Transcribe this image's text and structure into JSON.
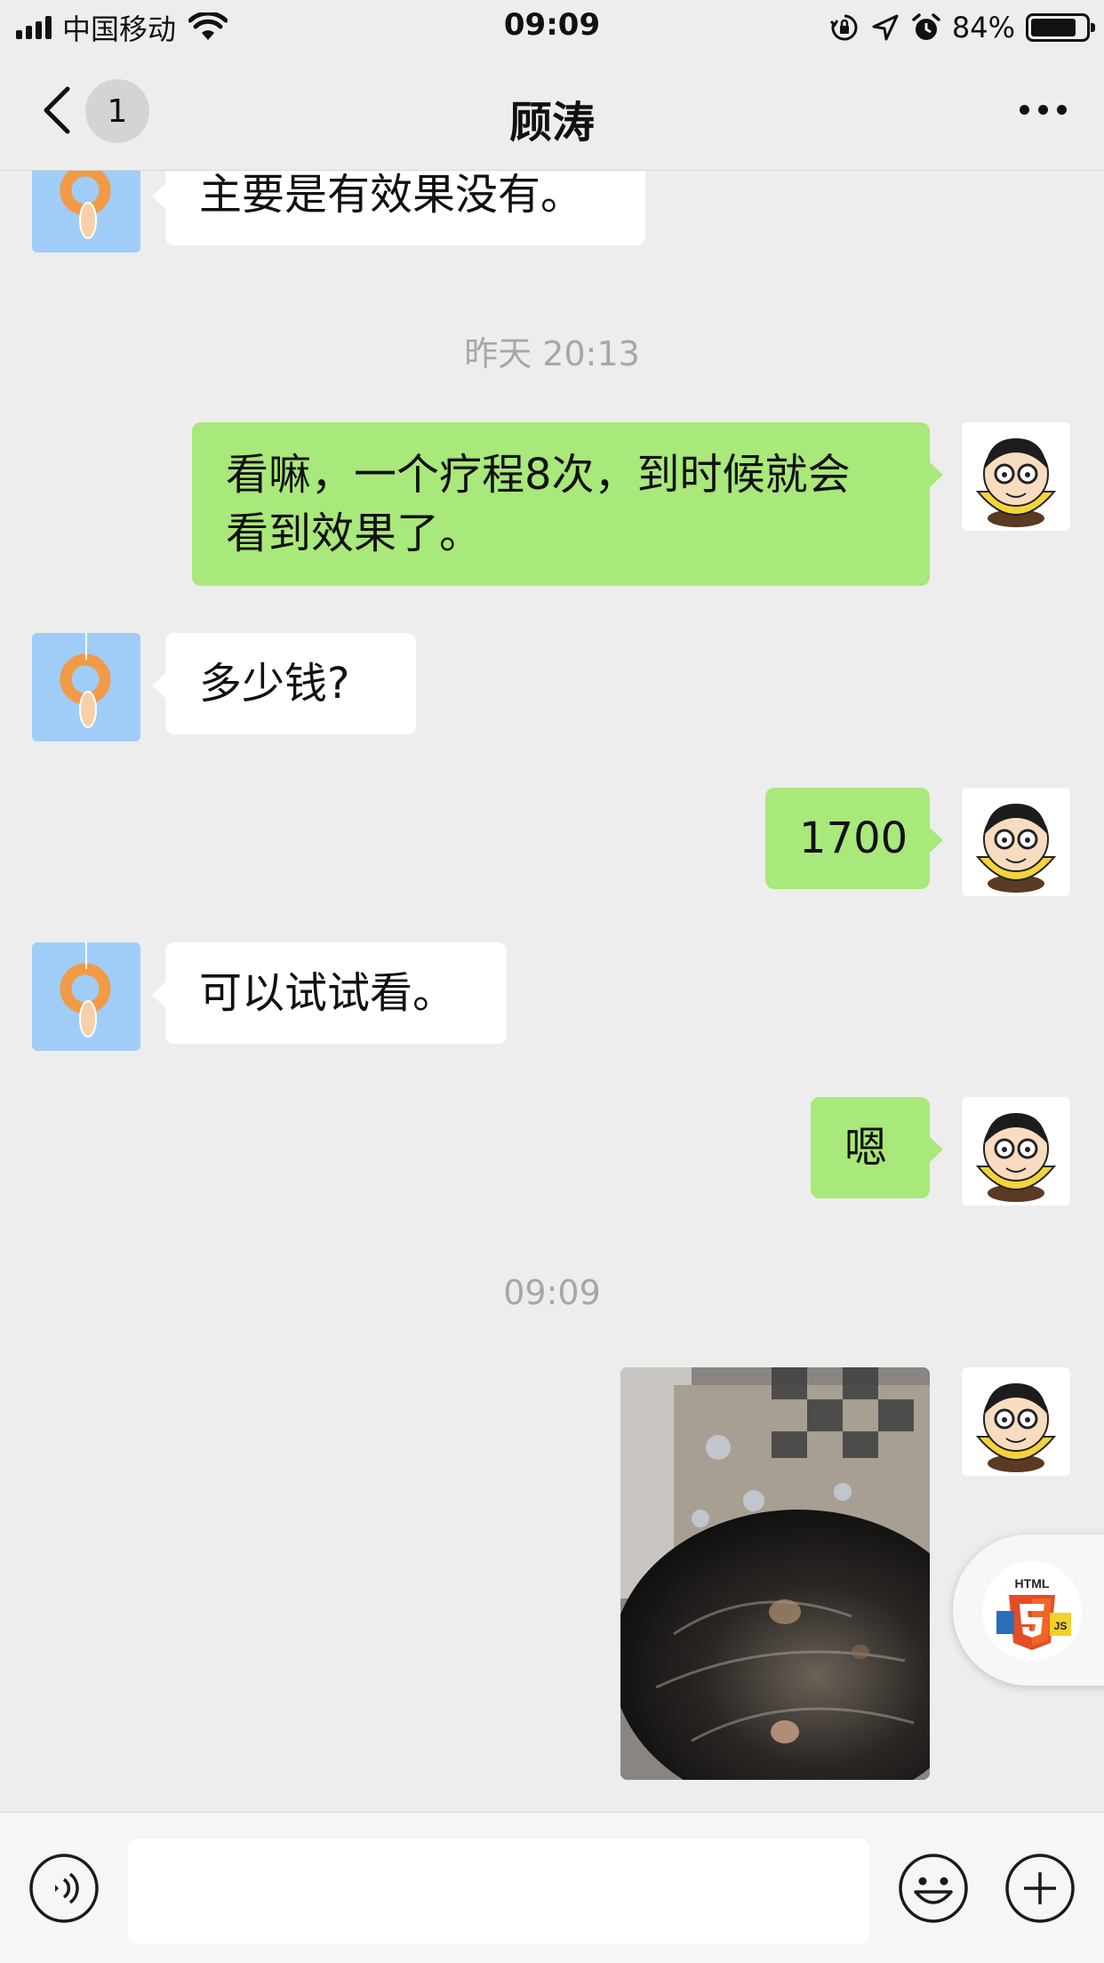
{
  "status_bar": {
    "carrier": "中国移动",
    "time": "09:09",
    "battery_percent": "84%",
    "battery_level": 0.84,
    "icons": [
      "signal-icon",
      "wifi-icon",
      "orientation-lock-icon",
      "location-icon",
      "alarm-icon",
      "battery-icon"
    ]
  },
  "nav": {
    "unread_count": "1",
    "title": "顾涛",
    "icons": [
      "back-arrow-icon",
      "more-icon"
    ]
  },
  "messages": [
    {
      "sender": "friend",
      "text": "主要是有效果没有。"
    },
    {
      "timestamp": "昨天 20:13"
    },
    {
      "sender": "me",
      "lines": [
        "看嘛，一个疗程8次，到时候就会",
        "看到效果了。"
      ]
    },
    {
      "sender": "friend",
      "text": "多少钱?"
    },
    {
      "sender": "me",
      "text": "1700"
    },
    {
      "sender": "friend",
      "text": "可以试试看。"
    },
    {
      "sender": "me",
      "text": "嗯"
    },
    {
      "timestamp": "09:09"
    },
    {
      "sender": "me",
      "type": "image"
    }
  ],
  "floating": {
    "icon": "html5-js-icon",
    "label_html": "HTML",
    "label_js": "JS"
  },
  "input_bar": {
    "placeholder": "",
    "icons": [
      "voice-icon",
      "emoji-icon",
      "plus-icon"
    ]
  },
  "colors": {
    "background": "#ededed",
    "my_bubble": "#a9e87a",
    "friend_bubble": "#ffffff",
    "timestamp": "#a7a7a7"
  }
}
